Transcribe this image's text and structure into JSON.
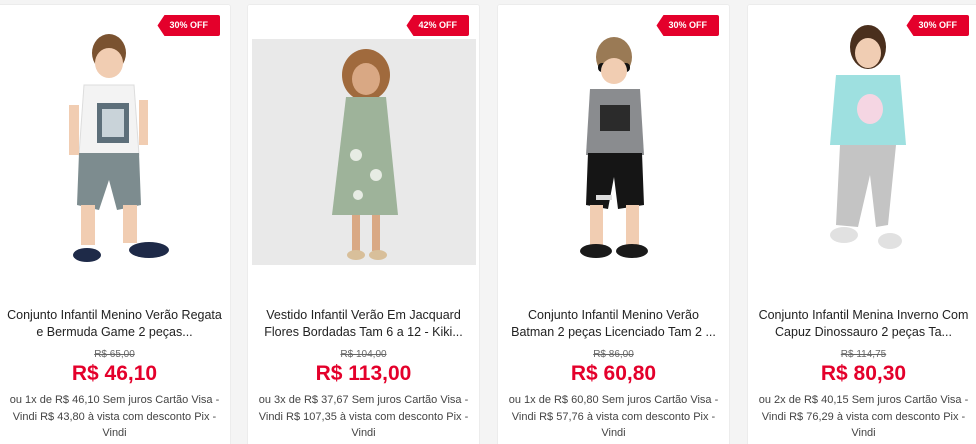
{
  "products": [
    {
      "discount": "30% OFF",
      "name": "Conjunto Infantil Menino Verão Regata e Bermuda Game 2 peças...",
      "old_price": "R$ 65,00",
      "price": "R$ 46,10",
      "installments": "ou 1x de R$ 46,10 Sem juros Cartão Visa - Vindi R$ 43,80 à vista com desconto Pix - Vindi"
    },
    {
      "discount": "42% OFF",
      "name": "Vestido Infantil Verão Em Jacquard Flores Bordadas Tam 6 a 12 - Kiki...",
      "old_price": "R$ 104,00",
      "price": "R$ 113,00",
      "installments": "ou 3x de R$ 37,67 Sem juros Cartão Visa - Vindi R$ 107,35 à vista com desconto Pix - Vindi"
    },
    {
      "discount": "30% OFF",
      "name": "Conjunto Infantil Menino Verão Batman 2 peças Licenciado Tam 2 ...",
      "old_price": "R$ 86,00",
      "price": "R$ 60,80",
      "installments": "ou 1x de R$ 60,80 Sem juros Cartão Visa - Vindi R$ 57,76 à vista com desconto Pix - Vindi"
    },
    {
      "discount": "30% OFF",
      "name": "Conjunto Infantil Menina Inverno Com Capuz Dinossauro 2 peças Ta...",
      "old_price": "R$ 114,75",
      "price": "R$ 80,30",
      "installments": "ou 2x de R$ 40,15 Sem juros Cartão Visa - Vindi R$ 76,29 à vista com desconto Pix - Vindi"
    }
  ],
  "colors": {
    "accent": "#e4002b",
    "text": "#222222"
  }
}
